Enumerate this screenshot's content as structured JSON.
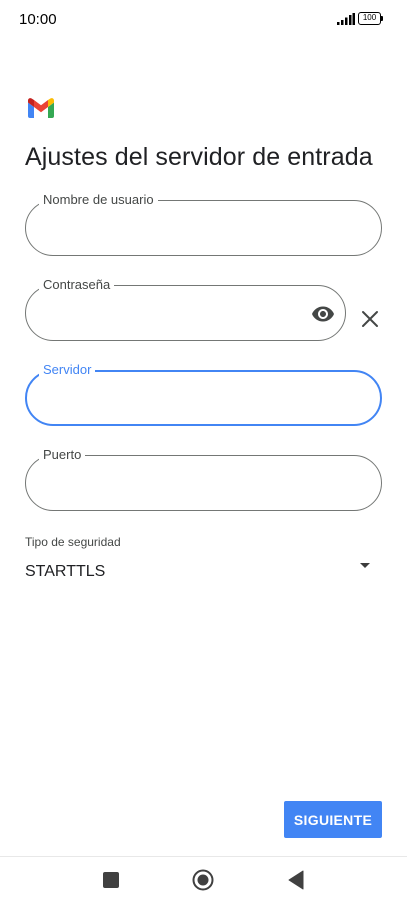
{
  "status_bar": {
    "time": "10:00",
    "battery_level": "100",
    "icons": [
      "signal-icon",
      "battery-icon"
    ]
  },
  "app": {
    "logo_icon": "gmail-logo-icon"
  },
  "page": {
    "title": "Ajustes del servidor de entrada"
  },
  "fields": {
    "username": {
      "label": "Nombre de usuario",
      "value": ""
    },
    "password": {
      "label": "Contraseña",
      "value": "",
      "icons": [
        "eye-icon",
        "close-icon"
      ]
    },
    "server": {
      "label": "Servidor",
      "value": "",
      "focused": true
    },
    "port": {
      "label": "Puerto",
      "value": ""
    }
  },
  "security": {
    "label": "Tipo de seguridad",
    "selected": "STARTTLS"
  },
  "actions": {
    "next_label": "SIGUIENTE"
  },
  "nav_bar": {
    "buttons": [
      "recents-button",
      "home-button",
      "back-button"
    ]
  },
  "colors": {
    "accent": "#4285f4",
    "outline": "#747775",
    "text": "#202124"
  }
}
